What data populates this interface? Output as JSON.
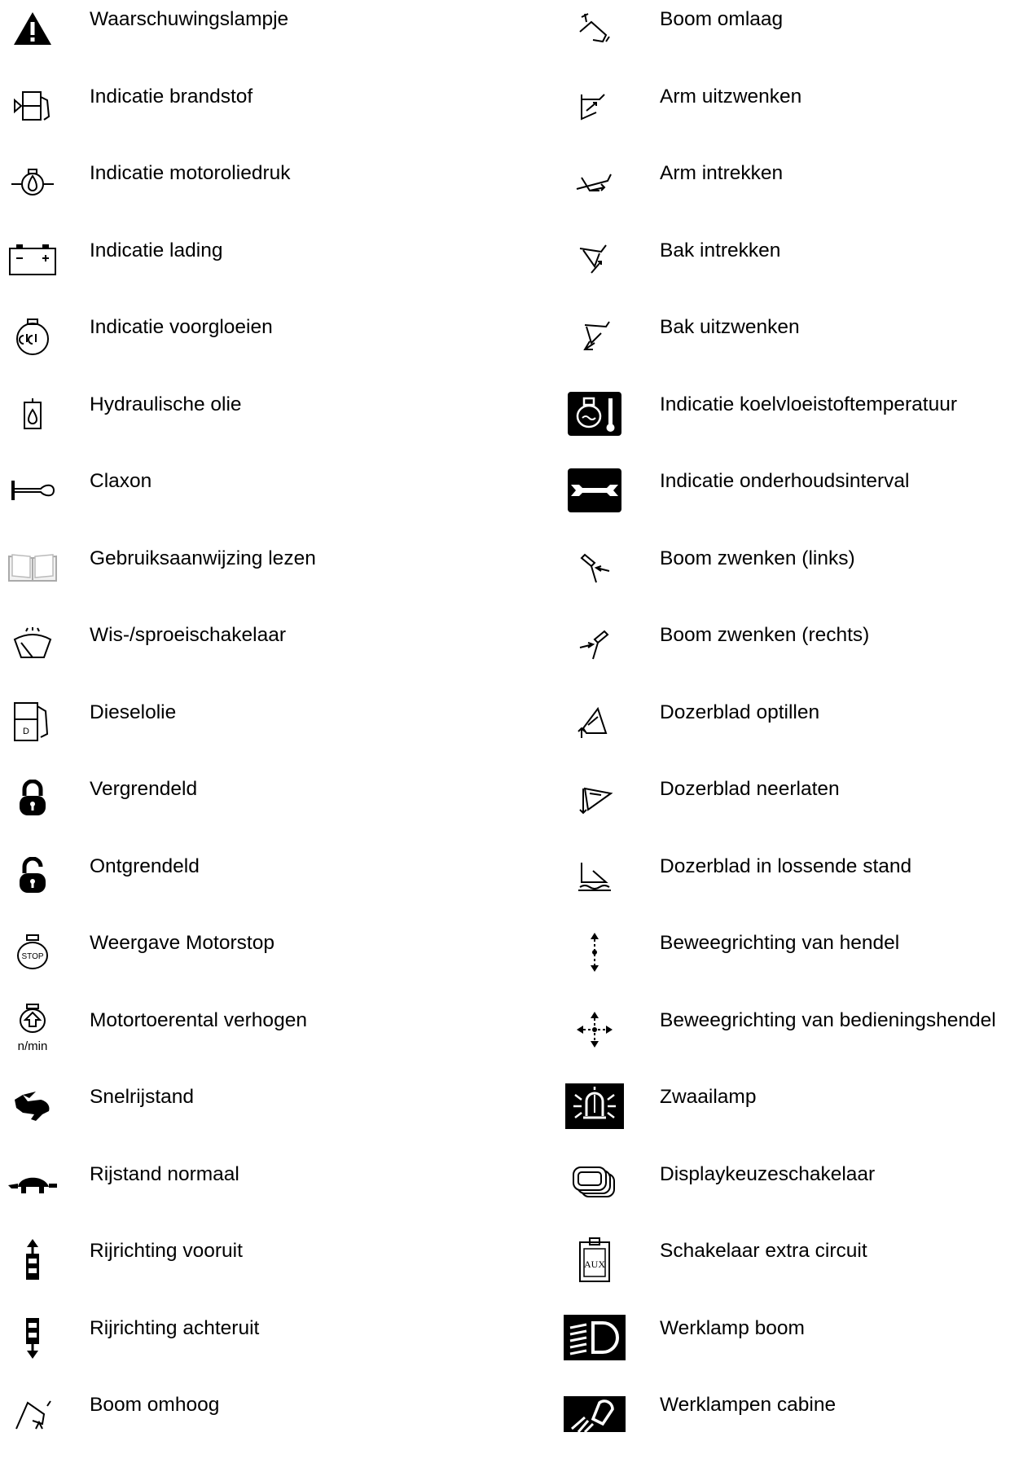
{
  "left_column": [
    {
      "icon": "warning-triangle-icon",
      "label": "Waarschuwingslampje"
    },
    {
      "icon": "fuel-level-icon",
      "label": "Indicatie brandstof"
    },
    {
      "icon": "engine-oil-pressure-icon",
      "label": "Indicatie motoroliedruk"
    },
    {
      "icon": "battery-charge-icon",
      "label": "Indicatie lading"
    },
    {
      "icon": "glow-plug-icon",
      "label": "Indicatie voorgloeien"
    },
    {
      "icon": "hydraulic-oil-icon",
      "label": "Hydraulische olie"
    },
    {
      "icon": "horn-icon",
      "label": "Claxon"
    },
    {
      "icon": "manual-book-icon",
      "label": "Gebruiksaanwijzing lezen"
    },
    {
      "icon": "wiper-washer-icon",
      "label": "Wis-/sproeischakelaar"
    },
    {
      "icon": "diesel-pump-icon",
      "label": "Dieselolie",
      "icon_text": "D"
    },
    {
      "icon": "lock-closed-icon",
      "label": "Vergrendeld"
    },
    {
      "icon": "lock-open-icon",
      "label": "Ontgrendeld"
    },
    {
      "icon": "engine-stop-icon",
      "label": "Weergave Motorstop",
      "icon_text": "STOP"
    },
    {
      "icon": "engine-speed-up-icon",
      "label": "Motortoerental verhogen",
      "icon_text": "n/min"
    },
    {
      "icon": "rabbit-icon",
      "label": "Snelrijstand"
    },
    {
      "icon": "turtle-icon",
      "label": "Rijstand normaal"
    },
    {
      "icon": "travel-forward-icon",
      "label": "Rijrichting vooruit"
    },
    {
      "icon": "travel-reverse-icon",
      "label": "Rijrichting achteruit"
    },
    {
      "icon": "boom-up-icon",
      "label": "Boom omhoog"
    }
  ],
  "right_column": [
    {
      "icon": "boom-down-icon",
      "label": "Boom omlaag"
    },
    {
      "icon": "arm-out-icon",
      "label": "Arm uitzwenken"
    },
    {
      "icon": "arm-in-icon",
      "label": "Arm intrekken"
    },
    {
      "icon": "bucket-in-icon",
      "label": "Bak intrekken"
    },
    {
      "icon": "bucket-out-icon",
      "label": "Bak uitzwenken"
    },
    {
      "icon": "coolant-temperature-icon",
      "label": "Indicatie koelvloeistoftemperatuur"
    },
    {
      "icon": "service-interval-wrench-icon",
      "label": "Indicatie onderhoudsinterval"
    },
    {
      "icon": "boom-swing-left-icon",
      "label": "Boom zwenken (links)"
    },
    {
      "icon": "boom-swing-right-icon",
      "label": "Boom zwenken (rechts)"
    },
    {
      "icon": "dozer-blade-raise-icon",
      "label": "Dozerblad optillen"
    },
    {
      "icon": "dozer-blade-lower-icon",
      "label": "Dozerblad neerlaten"
    },
    {
      "icon": "dozer-blade-float-icon",
      "label": "Dozerblad in lossende stand"
    },
    {
      "icon": "lever-direction-icon",
      "label": "Beweegrichting van hendel"
    },
    {
      "icon": "joystick-direction-icon",
      "label": "Beweegrichting van bedieningshendel"
    },
    {
      "icon": "beacon-light-icon",
      "label": "Zwaailamp"
    },
    {
      "icon": "display-select-icon",
      "label": "Displaykeuzeschakelaar"
    },
    {
      "icon": "aux-circuit-icon",
      "label": "Schakelaar extra circuit",
      "icon_text": "AUX"
    },
    {
      "icon": "boom-work-light-icon",
      "label": "Werklamp boom"
    },
    {
      "icon": "cab-work-lights-icon",
      "label": "Werklampen cabine"
    }
  ]
}
